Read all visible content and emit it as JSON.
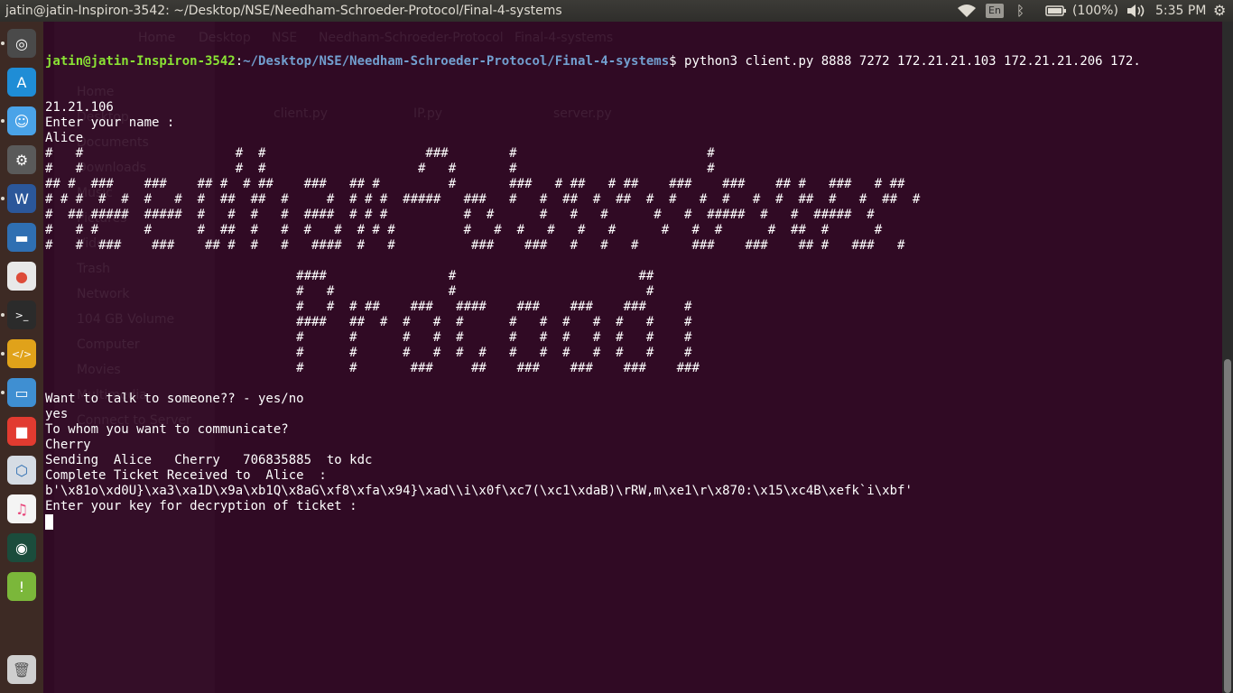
{
  "topbar": {
    "window_title": "jatin@jatin-Inspiron-3542: ~/Desktop/NSE/Needham-Schroeder-Protocol/Final-4-systems",
    "keyboard_layout": "En",
    "battery_label": "(100%)",
    "clock": "5:35 PM"
  },
  "launcher": {
    "items": [
      {
        "name": "ubuntu-dash-icon",
        "color": "#4a4a4a"
      },
      {
        "name": "app-store-icon",
        "color": "#1f8dd6"
      },
      {
        "name": "finder-icon",
        "color": "#4aa3e8"
      },
      {
        "name": "system-settings-icon",
        "color": "#5a5a5a"
      },
      {
        "name": "word-icon",
        "color": "#2b579a"
      },
      {
        "name": "disk-icon",
        "color": "#2f6fb2"
      },
      {
        "name": "chrome-icon",
        "color": "#e8e8e8"
      },
      {
        "name": "terminal-icon",
        "color": "#2b2b2b"
      },
      {
        "name": "code-editor-icon",
        "color": "#e0a21a"
      },
      {
        "name": "files-icon",
        "color": "#3f8fd2"
      },
      {
        "name": "video-record-icon",
        "color": "#e23b30"
      },
      {
        "name": "virtualbox-icon",
        "color": "#d6dce4"
      },
      {
        "name": "music-icon",
        "color": "#f4f4f4"
      },
      {
        "name": "tor-icon",
        "color": "#1b4c3c"
      },
      {
        "name": "android-installer-icon",
        "color": "#7bb73a"
      },
      {
        "name": "trash-icon",
        "color": "#cfcfcf"
      }
    ]
  },
  "terminal": {
    "prompt_user": "jatin@jatin-Inspiron-3542",
    "prompt_sep": ":",
    "prompt_path": "~/Desktop/NSE/Needham-Schroeder-Protocol/Final-4-systems",
    "prompt_cmd": "$ python3 client.py 8888 7272 172.21.21.103 172.21.21.206 172.",
    "output": [
      "21.21.106",
      "Enter your name :",
      "Alice",
      "#   #                    #  #                     ###        #                         #",
      "#   #                    #  #                    #   #       #                         #",
      "## #  ###    ###    ## #  # ##    ###   ## #         #       ###   # ##   # ##    ###    ###    ## #   ###   # ##",
      "# # #  #  #  #   #  #  ##  ##  #     #  # # #  #####   ###   #   #  ##  #  ##  #  #   #  #   #  #  ##  #   #  ##  #",
      "#  ## #####  #####  #   #  #   #  ####  # # #          #  #      #   #   #      #   #  #####  #   #  #####  #",
      "#   # #      #      #  ##  #   #  #   #  # # #         #   #  #   #   #   #      #   #  #      #  ##  #      #",
      "#   #  ###    ###    ## #  #   #   ####  #   #          ###    ###   #   #   #       ###    ###    ## #   ###   #",
      "",
      "                                 ####                #                        ##",
      "                                 #   #               #                         #",
      "                                 #   #  # ##    ###   ####    ###    ###    ###     #",
      "                                 ####   ##  #  #   #  #      #   #  #   #  #   #    #",
      "                                 #      #      #   #  #      #   #  #   #  #   #    #",
      "                                 #      #      #   #  #  #   #   #  #   #  #   #    #",
      "                                 #      #       ###     ##    ###    ###    ###    ###",
      "",
      "Want to talk to someone?? - yes/no",
      "yes",
      "To whom you want to communicate?",
      "Cherry",
      "Sending  Alice   Cherry   706835885  to kdc",
      "Complete Ticket Received to  Alice  :",
      "b'\\x81o\\xd0U}\\xa3\\xa1D\\x9a\\xb1Q\\x8aG\\xf8\\xfa\\x94}\\xad\\\\i\\x0f\\xc7(\\xc1\\xdaB)\\rRW,m\\xe1\\r\\x870:\\x15\\xc4B\\xefk`i\\xbf'",
      "Enter your key for decryption of ticket :"
    ]
  },
  "ghost": {
    "sidebar": [
      "Home",
      "Desktop",
      "Documents",
      "Downloads",
      "Music",
      "Pictures",
      "Videos",
      "Trash",
      "Network",
      "104 GB Volume",
      "Computer",
      "Movies",
      "Multimedia",
      "Connect to Server"
    ],
    "files": [
      "client.py",
      "IP.py",
      "server.py"
    ],
    "tabs": [
      "Home",
      "Desktop",
      "NSE",
      "Needham-Schroeder-Protocol",
      "Final-4-systems"
    ]
  }
}
